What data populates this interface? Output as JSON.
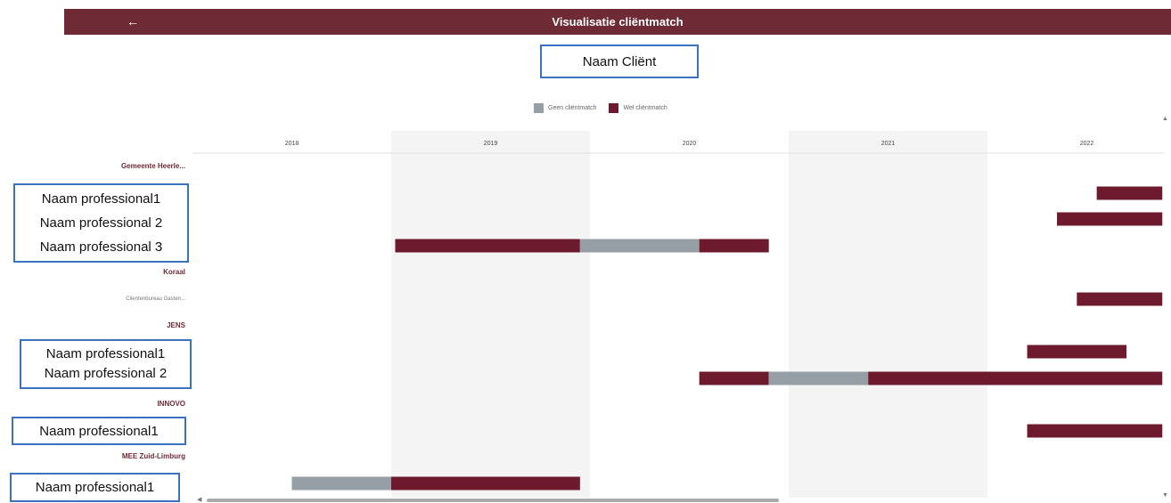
{
  "header": {
    "back_icon": "←",
    "title": "Visualisatie cliëntmatch"
  },
  "client": {
    "name": "Naam Cliënt"
  },
  "labels": {
    "org1": "Gemeente Heerle...",
    "box1": [
      "Naam professional1",
      "Naam professional 2",
      "Naam professional 3"
    ],
    "org2": "Koraal",
    "sub2": "Clientenbureau Gasten...",
    "org3": "JENS",
    "box2": [
      "Naam professional1",
      "Naam professional 2"
    ],
    "org4": "INNOVO",
    "box3": [
      "Naam professional1"
    ],
    "org5": "MEE Zuid-Limburg",
    "box4": [
      "Naam professional1"
    ]
  },
  "colors": {
    "geen": "#969ea6",
    "wel": "#6e1a2e",
    "header": "#6e2a35",
    "box_border": "#3a72c0",
    "band": "#f4f4f5"
  },
  "chart_data": {
    "type": "gantt",
    "x_axis": {
      "ticks": [
        "2018",
        "2019",
        "2020",
        "2021",
        "2022"
      ],
      "range": [
        2018.0,
        2022.88
      ]
    },
    "legend": [
      {
        "name": "Geen cliëntmatch",
        "color": "#969ea6"
      },
      {
        "name": "Wel cliëntmatch",
        "color": "#6e1a2e"
      }
    ],
    "legend_position": "top-center",
    "rows": [
      {
        "label": "Gemeente Heerle...",
        "segments": []
      },
      {
        "label": "Naam professional1",
        "segments": [
          {
            "start": 2022.55,
            "end": 2022.88,
            "match": "wel"
          }
        ]
      },
      {
        "label": "Naam professional 2",
        "segments": [
          {
            "start": 2022.35,
            "end": 2022.88,
            "match": "wel"
          }
        ]
      },
      {
        "label": "Naam professional 3",
        "segments": [
          {
            "start": 2019.02,
            "end": 2019.95,
            "match": "wel"
          },
          {
            "start": 2019.95,
            "end": 2020.55,
            "match": "geen"
          },
          {
            "start": 2020.55,
            "end": 2020.9,
            "match": "wel"
          }
        ]
      },
      {
        "label": "Koraal",
        "segments": []
      },
      {
        "label": "Clientenbureau Gasten...",
        "segments": [
          {
            "start": 2022.45,
            "end": 2022.88,
            "match": "wel"
          }
        ]
      },
      {
        "label": "JENS",
        "segments": []
      },
      {
        "label": "Naam professional1",
        "segments": [
          {
            "start": 2022.2,
            "end": 2022.7,
            "match": "wel"
          }
        ]
      },
      {
        "label": "Naam professional 2",
        "segments": [
          {
            "start": 2020.55,
            "end": 2020.9,
            "match": "wel"
          },
          {
            "start": 2020.9,
            "end": 2021.4,
            "match": "geen"
          },
          {
            "start": 2021.4,
            "end": 2022.88,
            "match": "wel"
          }
        ]
      },
      {
        "label": "INNOVO",
        "segments": []
      },
      {
        "label": "Naam professional1",
        "segments": [
          {
            "start": 2022.2,
            "end": 2022.88,
            "match": "wel"
          }
        ]
      },
      {
        "label": "MEE Zuid-Limburg",
        "segments": []
      },
      {
        "label": "Naam professional1",
        "segments": [
          {
            "start": 2018.5,
            "end": 2019.0,
            "match": "geen"
          },
          {
            "start": 2019.0,
            "end": 2019.95,
            "match": "wel"
          }
        ]
      }
    ]
  }
}
